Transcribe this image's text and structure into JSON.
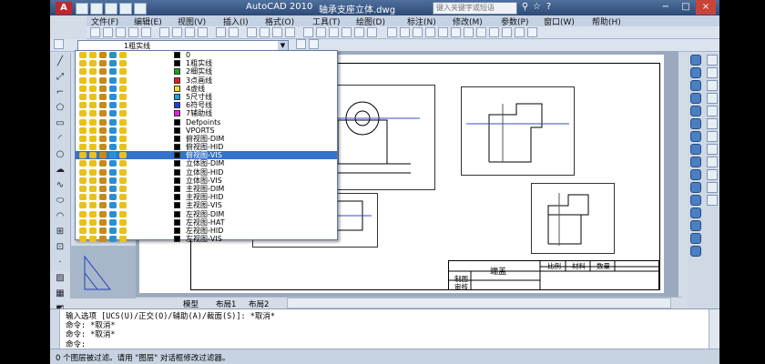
{
  "app": {
    "title": "AutoCAD 2010",
    "filename": "轴承支座立体.dwg",
    "search_placeholder": "键入关键字或短语",
    "logo": "A",
    "window_min": "−",
    "window_max": "□",
    "window_close": "×"
  },
  "menu": [
    "文件(F)",
    "编辑(E)",
    "视图(V)",
    "插入(I)",
    "格式(O)",
    "工具(T)",
    "绘图(D)",
    "标注(N)",
    "修改(M)",
    "参数(P)",
    "窗口(W)",
    "帮助(H)"
  ],
  "layer_dropdown": {
    "selected": "1粗实线",
    "arrow": "▼",
    "items": [
      {
        "name": "0",
        "color": "#000000",
        "highlight": false
      },
      {
        "name": "1粗实线",
        "color": "#000000",
        "highlight": false
      },
      {
        "name": "2细实线",
        "color": "#1aa31a",
        "highlight": false
      },
      {
        "name": "3点画线",
        "color": "#e02020",
        "highlight": false
      },
      {
        "name": "4虚线",
        "color": "#f0e020",
        "highlight": false
      },
      {
        "name": "5尺寸线",
        "color": "#20a0e0",
        "highlight": false
      },
      {
        "name": "6符号线",
        "color": "#2040e0",
        "highlight": false
      },
      {
        "name": "7辅助线",
        "color": "#e020e0",
        "highlight": false
      },
      {
        "name": "Defpoints",
        "color": "#000000",
        "highlight": false
      },
      {
        "name": "VPORTS",
        "color": "#000000",
        "highlight": false
      },
      {
        "name": "俯视图-DIM",
        "color": "#000000",
        "highlight": false
      },
      {
        "name": "俯视图-HID",
        "color": "#000000",
        "highlight": false
      },
      {
        "name": "俯视图-VIS",
        "color": "#000000",
        "highlight": true
      },
      {
        "name": "立体图-DIM",
        "color": "#000000",
        "highlight": false
      },
      {
        "name": "立体图-HID",
        "color": "#000000",
        "highlight": false
      },
      {
        "name": "立体图-VIS",
        "color": "#000000",
        "highlight": false
      },
      {
        "name": "主视图-DIM",
        "color": "#000000",
        "highlight": false
      },
      {
        "name": "主视图-HID",
        "color": "#000000",
        "highlight": false
      },
      {
        "name": "主视图-VIS",
        "color": "#000000",
        "highlight": false
      },
      {
        "name": "左视图-DIM",
        "color": "#000000",
        "highlight": false
      },
      {
        "name": "左视图-HAT",
        "color": "#000000",
        "highlight": false
      },
      {
        "name": "左视图-HID",
        "color": "#000000",
        "highlight": false
      },
      {
        "name": "左视图-VIS",
        "color": "#000000",
        "highlight": false
      }
    ]
  },
  "title_block": {
    "name": "端盖",
    "cells": [
      "比例",
      "材料",
      "数量"
    ],
    "rows": [
      "制图",
      "审核"
    ]
  },
  "tabs": {
    "model": "模型",
    "layout1": "布局1",
    "layout2": "布局2"
  },
  "command": {
    "line1": "输入选项 [UCS(U)/正交(O)/辅助(A)/截面(S)]: *取消*",
    "line2": "命令: *取消*",
    "line3": "命令: *取消*",
    "prompt": "命令:"
  },
  "status_text": "0 个图层被过滤。请用 \"图层\" 对话框修改过滤器。",
  "colors": {
    "highlight": "#3373c9",
    "title_bar": "#2c4a77"
  }
}
